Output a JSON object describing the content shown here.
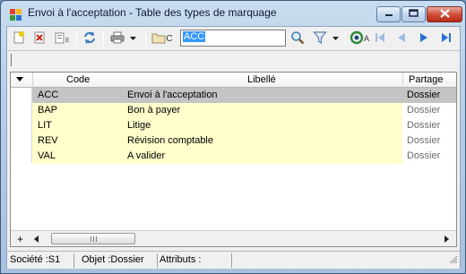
{
  "window": {
    "title": "Envoi à l'acceptation -  Table des types de marquage",
    "icons": {
      "app": "app-icon",
      "minimize": "minimize-icon",
      "maximize": "maximize-icon",
      "close": "close-icon"
    }
  },
  "toolbar": {
    "buttons": [
      "new-icon",
      "delete-icon",
      "export-icon",
      "refresh-icon",
      "print-icon",
      "dropdown-icon",
      "folder-icon",
      "search-icon",
      "filter-icon",
      "dropdown-icon",
      "settings-icon",
      "first-icon",
      "previous-icon",
      "next-icon",
      "last-icon"
    ],
    "folder_label": "C",
    "go_label": "A",
    "search_value": "ACC"
  },
  "grid": {
    "columns": [
      "Code",
      "Libellé",
      "Partage"
    ],
    "rows": [
      {
        "code": "ACC",
        "libelle": "Envoi à l'acceptation",
        "partage": "Dossier",
        "selected": true
      },
      {
        "code": "BAP",
        "libelle": "Bon à payer",
        "partage": "Dossier",
        "selected": false
      },
      {
        "code": "LIT",
        "libelle": "Litige",
        "partage": "Dossier",
        "selected": false
      },
      {
        "code": "REV",
        "libelle": "Révision comptable",
        "partage": "Dossier",
        "selected": false
      },
      {
        "code": "VAL",
        "libelle": "A valider",
        "partage": "Dossier",
        "selected": false
      }
    ],
    "add_label": "+"
  },
  "status": {
    "societe": "Société :S1",
    "objet": "Objet :Dossier",
    "attributs": "Attributs :"
  },
  "colors": {
    "selected_row": "#c4c4c4",
    "editable_cells": "#ffffcc",
    "search_highlight": "#3399ff"
  }
}
